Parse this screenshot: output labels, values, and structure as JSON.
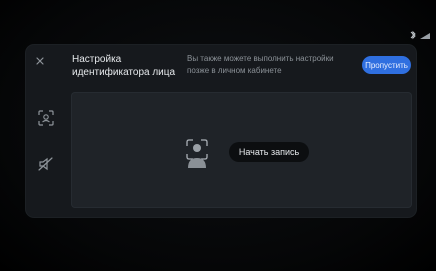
{
  "dialog": {
    "title": "Настройка идентификатора лица",
    "hint": "Вы также можете выполнить настройки позже в личном кабинете",
    "skip_label": "Пропустить",
    "record_label": "Начать запись"
  },
  "icons": {
    "close": "close-icon",
    "face_scan": "face-scan-icon",
    "mute": "mute-icon",
    "face_id": "face-id-icon",
    "status": [
      "bluetooth-icon",
      "signal-icon"
    ]
  },
  "colors": {
    "accent": "#2f6fe0",
    "dialog_bg": "#16191d",
    "preview_bg": "#1f2328",
    "text": "#e6e9ec",
    "muted_text": "#8b9197"
  }
}
